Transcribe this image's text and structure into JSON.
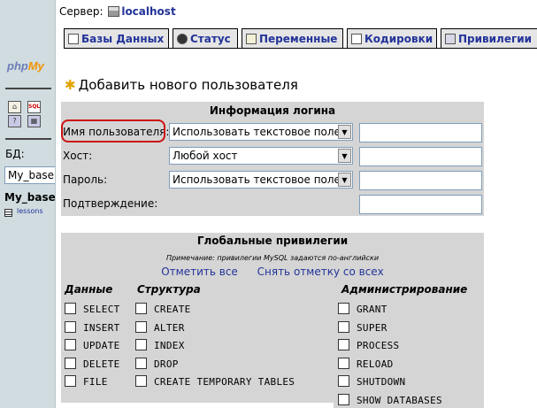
{
  "left": {
    "logo_php": "php",
    "logo_my": "My",
    "db_label": "БД:",
    "db_selected": "My_base",
    "db_name": "My_base",
    "table_name": "lessons"
  },
  "header": {
    "server_label": "Сервер:",
    "server_host": "localhost"
  },
  "tabs": [
    {
      "label": "Базы Данных",
      "icon": "databases-icon"
    },
    {
      "label": "Статус",
      "icon": "status-icon"
    },
    {
      "label": "Переменные",
      "icon": "variables-icon"
    },
    {
      "label": "Кодировки",
      "icon": "charsets-icon"
    },
    {
      "label": "Привилегии",
      "icon": "privileges-icon"
    }
  ],
  "page_title": "Добавить нового пользователя",
  "login": {
    "heading": "Информация логина",
    "user_label": "Имя пользователя:",
    "user_select": "Использовать текстовое поле:",
    "host_label": "Хост:",
    "host_select": "Любой хост",
    "password_label": "Пароль:",
    "password_select": "Использовать текстовое поле:",
    "confirm_label": "Подтверждение:"
  },
  "privileges": {
    "heading": "Глобальные привилегии",
    "note": "Примечание: привилегии MySQL задаются по-английски",
    "check_all": "Отметить все",
    "uncheck_all": "Снять отметку со всех",
    "col_data": "Данные",
    "col_structure": "Структура",
    "col_admin": "Администрирование",
    "data_items": [
      "SELECT",
      "INSERT",
      "UPDATE",
      "DELETE",
      "FILE"
    ],
    "structure_items": [
      "CREATE",
      "ALTER",
      "INDEX",
      "DROP",
      "CREATE TEMPORARY TABLES"
    ],
    "admin_items": [
      "GRANT",
      "SUPER",
      "PROCESS",
      "RELOAD",
      "SHUTDOWN",
      "SHOW DATABASES"
    ]
  },
  "colors": {
    "link": "#223399",
    "panel": "#d5d5d5",
    "left_frame": "#d0dce0",
    "highlight": "#cc1111"
  }
}
